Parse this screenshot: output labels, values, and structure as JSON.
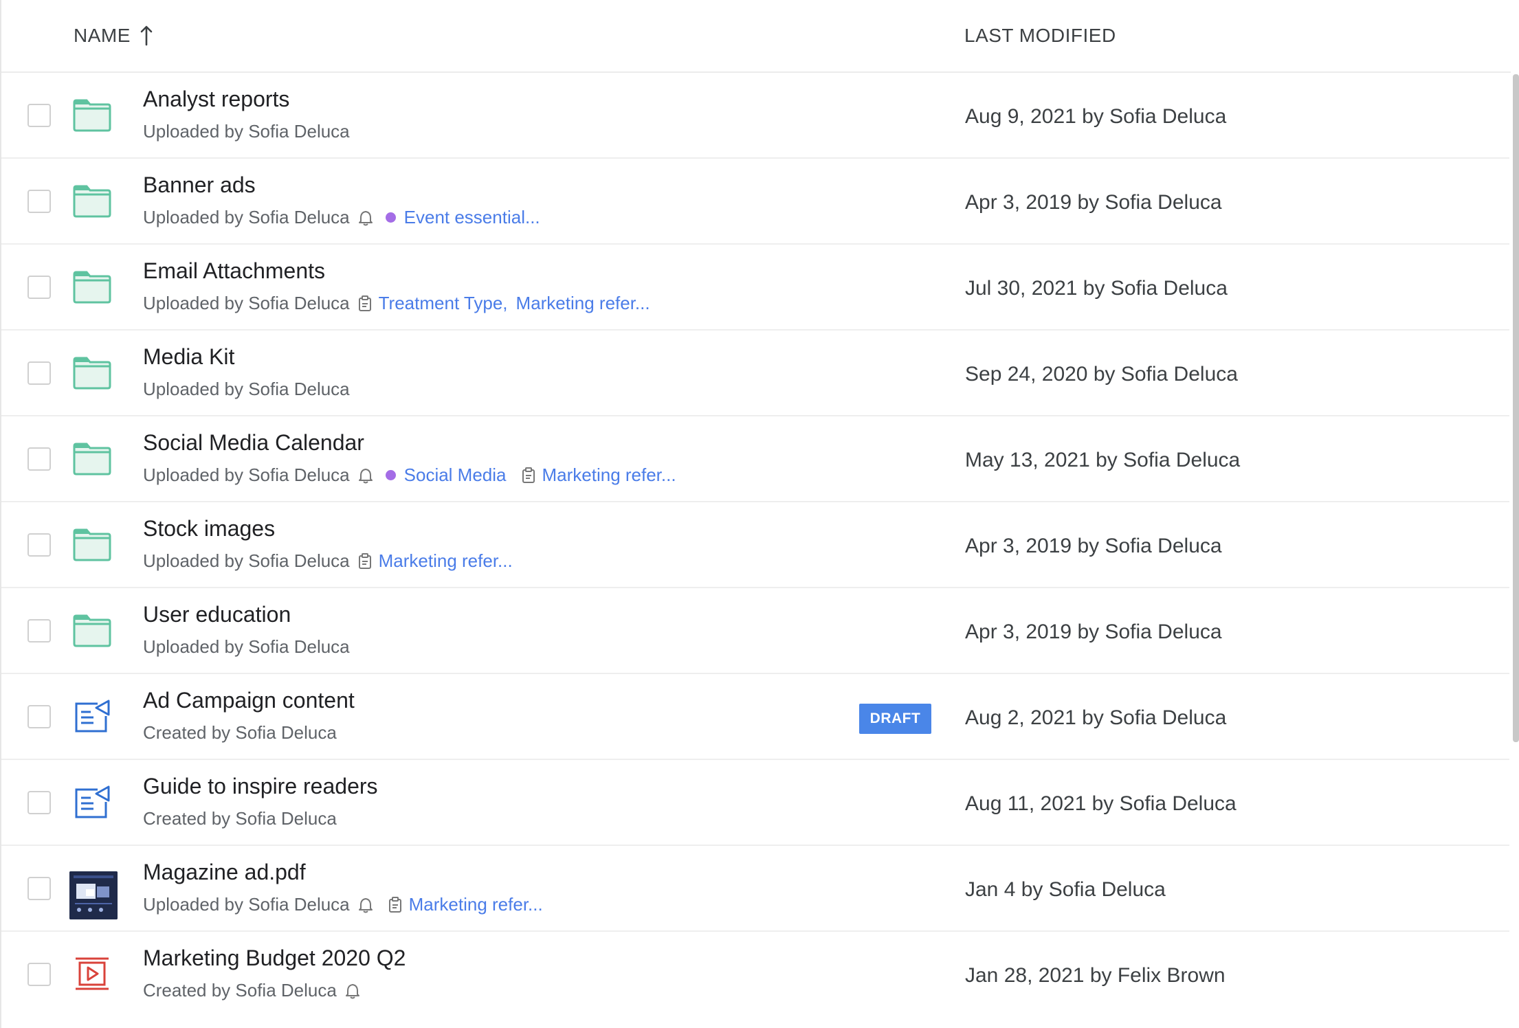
{
  "header": {
    "name_label": "NAME",
    "sort_icon": "arrow-up-icon",
    "modified_label": "LAST MODIFIED"
  },
  "colors": {
    "folder": "#5fc3a0",
    "folder_fill": "#e6f5ee",
    "link": "#4a7ce8",
    "badge": "#4a86e8",
    "tag_dot": "#a46de6",
    "doc_icon": "#2f6fd1",
    "video_icon": "#d9423a"
  },
  "rows": [
    {
      "icon": "folder-icon",
      "title": "Analyst reports",
      "subtitle": "Uploaded by Sofia Deluca",
      "tags": [],
      "modified": "Aug 9, 2021 by Sofia Deluca"
    },
    {
      "icon": "folder-icon",
      "title": "Banner ads",
      "subtitle": "Uploaded by Sofia Deluca",
      "notify": true,
      "tags": [
        {
          "kind": "dot",
          "label": "Event essential..."
        }
      ],
      "modified": "Apr 3, 2019 by Sofia Deluca"
    },
    {
      "icon": "folder-icon",
      "title": "Email Attachments",
      "subtitle": "Uploaded by Sofia Deluca",
      "tags": [
        {
          "kind": "clipboard",
          "label": "Treatment Type"
        },
        {
          "kind": "plain",
          "label": "Marketing refer..."
        }
      ],
      "modified": "Jul 30, 2021 by Sofia Deluca"
    },
    {
      "icon": "folder-icon",
      "title": "Media Kit",
      "subtitle": "Uploaded by Sofia Deluca",
      "tags": [],
      "modified": "Sep 24, 2020 by Sofia Deluca"
    },
    {
      "icon": "folder-icon",
      "title": "Social Media Calendar",
      "subtitle": "Uploaded by Sofia Deluca",
      "notify": true,
      "tags": [
        {
          "kind": "dot",
          "label": "Social Media"
        },
        {
          "kind": "clipboard",
          "label": "Marketing refer..."
        }
      ],
      "modified": "May 13, 2021 by Sofia Deluca"
    },
    {
      "icon": "folder-icon",
      "title": "Stock images",
      "subtitle": "Uploaded by Sofia Deluca",
      "tags": [
        {
          "kind": "clipboard",
          "label": "Marketing refer..."
        }
      ],
      "modified": "Apr 3, 2019 by Sofia Deluca"
    },
    {
      "icon": "folder-icon",
      "title": "User education",
      "subtitle": "Uploaded by Sofia Deluca",
      "tags": [],
      "modified": "Apr 3, 2019 by Sofia Deluca"
    },
    {
      "icon": "document-send-icon",
      "title": "Ad Campaign content",
      "subtitle": "Created by Sofia Deluca",
      "badge": "DRAFT",
      "tags": [],
      "modified": "Aug 2, 2021 by Sofia Deluca"
    },
    {
      "icon": "document-send-icon",
      "title": "Guide to inspire readers",
      "subtitle": "Created by Sofia Deluca",
      "tags": [],
      "modified": "Aug 11, 2021 by Sofia Deluca"
    },
    {
      "icon": "pdf-thumbnail-icon",
      "title": "Magazine ad.pdf",
      "subtitle": "Uploaded by Sofia Deluca",
      "notify": true,
      "tags": [
        {
          "kind": "clipboard",
          "label": "Marketing refer..."
        }
      ],
      "modified": "Jan 4 by Sofia Deluca"
    },
    {
      "icon": "video-icon",
      "title": "Marketing Budget 2020 Q2",
      "subtitle": "Created by Sofia Deluca",
      "notify": true,
      "tags": [],
      "modified": "Jan 28, 2021 by Felix Brown"
    }
  ]
}
